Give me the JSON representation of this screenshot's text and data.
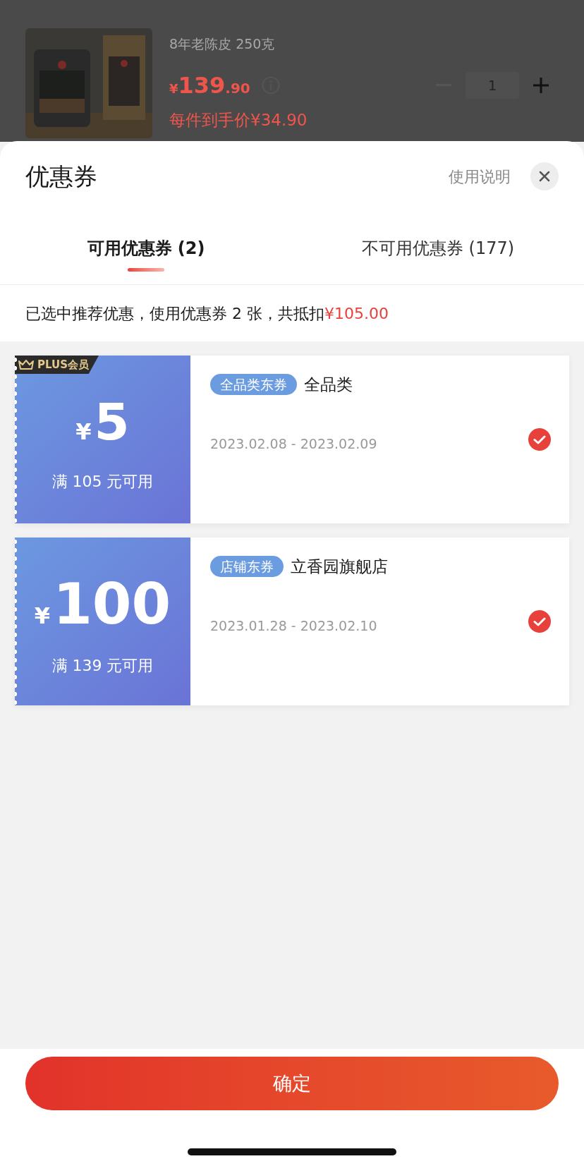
{
  "background_product": {
    "spec": "8年老陈皮 250克",
    "currency": "¥",
    "price": "139",
    "price_decimal": ".90",
    "per_item": "每件到手价¥34.90",
    "quantity": "1"
  },
  "sheet": {
    "title": "优惠券",
    "help_link": "使用说明"
  },
  "tabs": [
    {
      "label": "可用优惠券 (2)",
      "selected": true
    },
    {
      "label": "不可用优惠券 (177)",
      "selected": false
    }
  ],
  "summary": {
    "text": "已选中推荐优惠，使用优惠券 2 张，共抵扣",
    "amount": "¥105.00"
  },
  "coupons": [
    {
      "badge": "PLUS会员",
      "currency": "¥",
      "amount": "5",
      "condition": "满 105 元可用",
      "tag": "全品类东券",
      "scope": "全品类",
      "validity": "2023.02.08 - 2023.02.09",
      "selected": true
    },
    {
      "currency": "¥",
      "amount": "100",
      "condition": "满 139 元可用",
      "tag": "店铺东券",
      "scope": "立香园旗舰店",
      "validity": "2023.01.28 - 2023.02.10",
      "selected": true
    }
  ],
  "confirm_button": "确定"
}
